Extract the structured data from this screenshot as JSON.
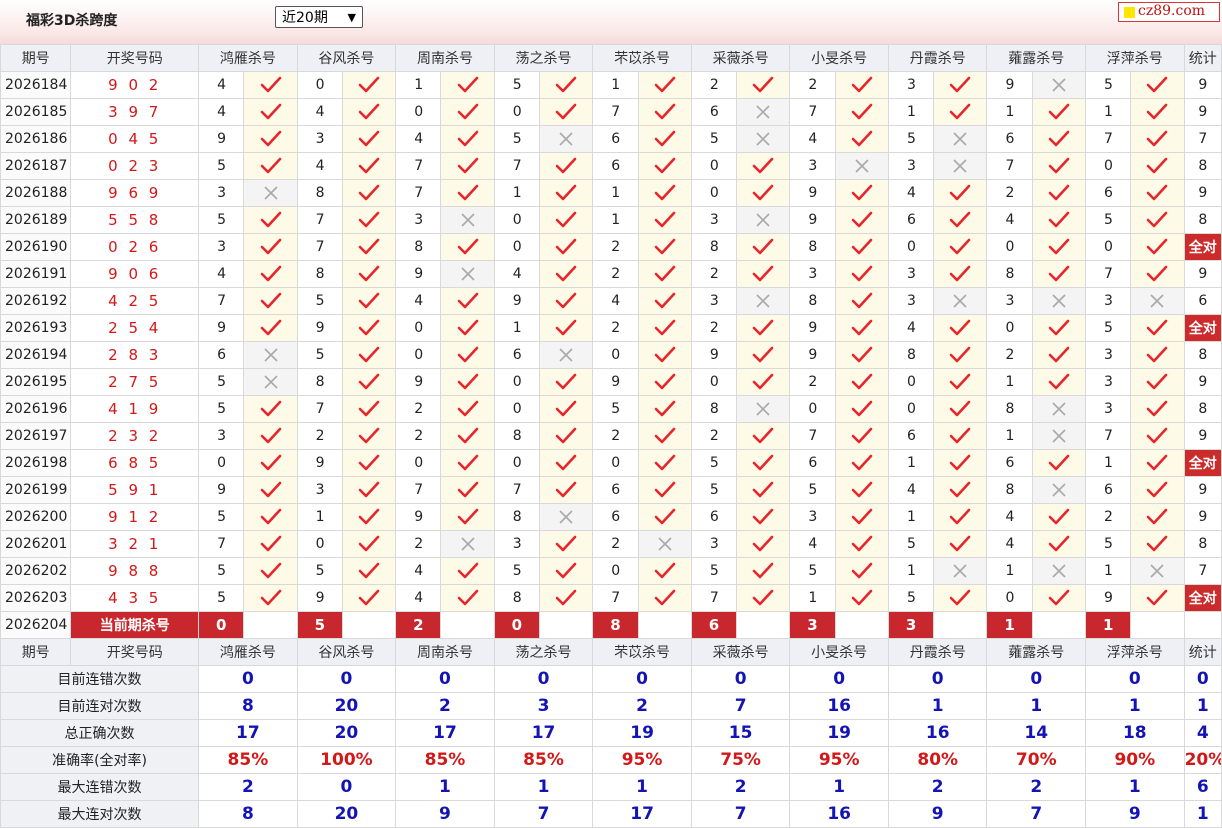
{
  "header": {
    "title": "福彩3D杀跨度",
    "period_select": "近20期",
    "site_logo_text": "cz89.com"
  },
  "columns": {
    "period": "期号",
    "draw": "开奖号码",
    "experts": [
      "鸿雁杀号",
      "谷风杀号",
      "周南杀号",
      "荡之杀号",
      "芣苡杀号",
      "采薇杀号",
      "小旻杀号",
      "丹霞杀号",
      "蕹露杀号",
      "浮萍杀号"
    ],
    "stat": "统计"
  },
  "rows": [
    {
      "period": "2026184",
      "draw": "9 0 2",
      "kills": [
        4,
        0,
        1,
        5,
        1,
        2,
        2,
        3,
        9,
        5
      ],
      "hits": [
        1,
        1,
        1,
        1,
        1,
        1,
        1,
        1,
        0,
        1
      ],
      "stat": "9"
    },
    {
      "period": "2026185",
      "draw": "3 9 7",
      "kills": [
        4,
        4,
        0,
        0,
        7,
        6,
        7,
        1,
        1,
        1
      ],
      "hits": [
        1,
        1,
        1,
        1,
        1,
        0,
        1,
        1,
        1,
        1
      ],
      "stat": "9"
    },
    {
      "period": "2026186",
      "draw": "0 4 5",
      "kills": [
        9,
        3,
        4,
        5,
        6,
        5,
        4,
        5,
        6,
        7
      ],
      "hits": [
        1,
        1,
        1,
        0,
        1,
        0,
        1,
        0,
        1,
        1
      ],
      "stat": "7"
    },
    {
      "period": "2026187",
      "draw": "0 2 3",
      "kills": [
        5,
        4,
        7,
        7,
        6,
        0,
        3,
        3,
        7,
        0
      ],
      "hits": [
        1,
        1,
        1,
        1,
        1,
        1,
        0,
        0,
        1,
        1
      ],
      "stat": "8"
    },
    {
      "period": "2026188",
      "draw": "9 6 9",
      "kills": [
        3,
        8,
        7,
        1,
        1,
        0,
        9,
        4,
        2,
        6
      ],
      "hits": [
        0,
        1,
        1,
        1,
        1,
        1,
        1,
        1,
        1,
        1
      ],
      "stat": "9"
    },
    {
      "period": "2026189",
      "draw": "5 5 8",
      "kills": [
        5,
        7,
        3,
        0,
        1,
        3,
        9,
        6,
        4,
        5
      ],
      "hits": [
        1,
        1,
        0,
        1,
        1,
        0,
        1,
        1,
        1,
        1
      ],
      "stat": "8"
    },
    {
      "period": "2026190",
      "draw": "0 2 6",
      "kills": [
        3,
        7,
        8,
        0,
        2,
        8,
        8,
        0,
        0,
        0
      ],
      "hits": [
        1,
        1,
        1,
        1,
        1,
        1,
        1,
        1,
        1,
        1
      ],
      "stat": "全对"
    },
    {
      "period": "2026191",
      "draw": "9 0 6",
      "kills": [
        4,
        8,
        9,
        4,
        2,
        2,
        3,
        3,
        8,
        7
      ],
      "hits": [
        1,
        1,
        0,
        1,
        1,
        1,
        1,
        1,
        1,
        1
      ],
      "stat": "9"
    },
    {
      "period": "2026192",
      "draw": "4 2 5",
      "kills": [
        7,
        5,
        4,
        9,
        4,
        3,
        8,
        3,
        3,
        3
      ],
      "hits": [
        1,
        1,
        1,
        1,
        1,
        0,
        1,
        0,
        0,
        0
      ],
      "stat": "6"
    },
    {
      "period": "2026193",
      "draw": "2 5 4",
      "kills": [
        9,
        9,
        0,
        1,
        2,
        2,
        9,
        4,
        0,
        5
      ],
      "hits": [
        1,
        1,
        1,
        1,
        1,
        1,
        1,
        1,
        1,
        1
      ],
      "stat": "全对"
    },
    {
      "period": "2026194",
      "draw": "2 8 3",
      "kills": [
        6,
        5,
        0,
        6,
        0,
        9,
        9,
        8,
        2,
        3
      ],
      "hits": [
        0,
        1,
        1,
        0,
        1,
        1,
        1,
        1,
        1,
        1
      ],
      "stat": "8"
    },
    {
      "period": "2026195",
      "draw": "2 7 5",
      "kills": [
        5,
        8,
        9,
        0,
        9,
        0,
        2,
        0,
        1,
        3
      ],
      "hits": [
        0,
        1,
        1,
        1,
        1,
        1,
        1,
        1,
        1,
        1
      ],
      "stat": "9"
    },
    {
      "period": "2026196",
      "draw": "4 1 9",
      "kills": [
        5,
        7,
        2,
        0,
        5,
        8,
        0,
        0,
        8,
        3
      ],
      "hits": [
        1,
        1,
        1,
        1,
        1,
        0,
        1,
        1,
        0,
        1
      ],
      "stat": "8"
    },
    {
      "period": "2026197",
      "draw": "2 3 2",
      "kills": [
        3,
        2,
        2,
        8,
        2,
        2,
        7,
        6,
        1,
        7
      ],
      "hits": [
        1,
        1,
        1,
        1,
        1,
        1,
        1,
        1,
        0,
        1
      ],
      "stat": "9"
    },
    {
      "period": "2026198",
      "draw": "6 8 5",
      "kills": [
        0,
        9,
        0,
        0,
        0,
        5,
        6,
        1,
        6,
        1
      ],
      "hits": [
        1,
        1,
        1,
        1,
        1,
        1,
        1,
        1,
        1,
        1
      ],
      "stat": "全对"
    },
    {
      "period": "2026199",
      "draw": "5 9 1",
      "kills": [
        9,
        3,
        7,
        7,
        6,
        5,
        5,
        4,
        8,
        6
      ],
      "hits": [
        1,
        1,
        1,
        1,
        1,
        1,
        1,
        1,
        0,
        1
      ],
      "stat": "9"
    },
    {
      "period": "2026200",
      "draw": "9 1 2",
      "kills": [
        5,
        1,
        9,
        8,
        6,
        6,
        3,
        1,
        4,
        2
      ],
      "hits": [
        1,
        1,
        1,
        0,
        1,
        1,
        1,
        1,
        1,
        1
      ],
      "stat": "9"
    },
    {
      "period": "2026201",
      "draw": "3 2 1",
      "kills": [
        7,
        0,
        2,
        3,
        2,
        3,
        4,
        5,
        4,
        5
      ],
      "hits": [
        1,
        1,
        0,
        1,
        0,
        1,
        1,
        1,
        1,
        1
      ],
      "stat": "8"
    },
    {
      "period": "2026202",
      "draw": "9 8 8",
      "kills": [
        5,
        5,
        4,
        5,
        0,
        5,
        5,
        1,
        1,
        1
      ],
      "hits": [
        1,
        1,
        1,
        1,
        1,
        1,
        1,
        0,
        0,
        0
      ],
      "stat": "7"
    },
    {
      "period": "2026203",
      "draw": "4 3 5",
      "kills": [
        5,
        9,
        4,
        8,
        7,
        7,
        1,
        5,
        0,
        9
      ],
      "hits": [
        1,
        1,
        1,
        1,
        1,
        1,
        1,
        1,
        1,
        1
      ],
      "stat": "全对"
    }
  ],
  "current": {
    "period": "2026204",
    "label": "当前期杀号",
    "kills": [
      "0",
      "5",
      "2",
      "0",
      "8",
      "6",
      "3",
      "3",
      "1",
      "1"
    ]
  },
  "summary_labels": [
    "目前连错次数",
    "目前连对次数",
    "总正确次数",
    "准确率(全对率)",
    "最大连错次数",
    "最大连对次数"
  ],
  "summary_values": [
    [
      "0",
      "0",
      "0",
      "0",
      "0",
      "0",
      "0",
      "0",
      "0",
      "0",
      "0"
    ],
    [
      "8",
      "20",
      "2",
      "3",
      "2",
      "7",
      "16",
      "1",
      "1",
      "1",
      "1"
    ],
    [
      "17",
      "20",
      "17",
      "17",
      "19",
      "15",
      "19",
      "16",
      "14",
      "18",
      "4"
    ],
    [
      "85%",
      "100%",
      "85%",
      "85%",
      "95%",
      "75%",
      "95%",
      "80%",
      "70%",
      "90%",
      "20%"
    ],
    [
      "2",
      "0",
      "1",
      "1",
      "1",
      "2",
      "1",
      "2",
      "2",
      "1",
      "6"
    ],
    [
      "8",
      "20",
      "9",
      "7",
      "17",
      "7",
      "16",
      "9",
      "7",
      "9",
      "1"
    ]
  ],
  "colors": {
    "hit": "#e8252b",
    "miss": "#a9a9a9",
    "accent": "#c8272d",
    "summary_blue": "#1414b4"
  }
}
